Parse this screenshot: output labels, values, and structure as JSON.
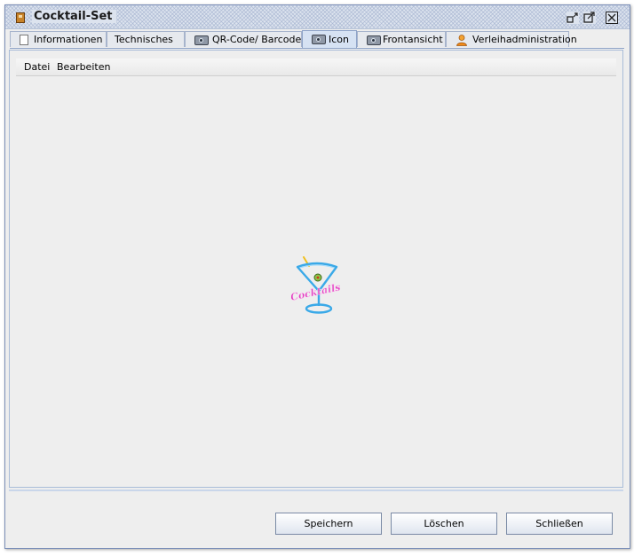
{
  "window": {
    "title": "Cocktail-Set",
    "controls": [
      "restore-icon",
      "maximize-icon",
      "close-icon"
    ]
  },
  "tabs": [
    {
      "label": "Informationen",
      "icon": "document-icon",
      "active": false
    },
    {
      "label": "Technisches",
      "icon": "",
      "active": false
    },
    {
      "label": "QR-Code/ Barcode",
      "icon": "camera-icon",
      "active": false
    },
    {
      "label": "Icon",
      "icon": "camera-icon",
      "active": true
    },
    {
      "label": "Frontansicht",
      "icon": "camera-icon",
      "active": false
    },
    {
      "label": "Verleihadministration",
      "icon": "user-icon",
      "active": false
    }
  ],
  "menubar": {
    "items": [
      "Datei",
      "Bearbeiten"
    ]
  },
  "image": {
    "logo_text": "Cocktails",
    "icon": "cocktail-glass-icon"
  },
  "buttons": {
    "save": "Speichern",
    "delete": "Löschen",
    "close": "Schließen"
  },
  "colors": {
    "accent": "#8ea3c8",
    "neon_blue": "#3aa9e8",
    "neon_pink": "#e040c0"
  }
}
